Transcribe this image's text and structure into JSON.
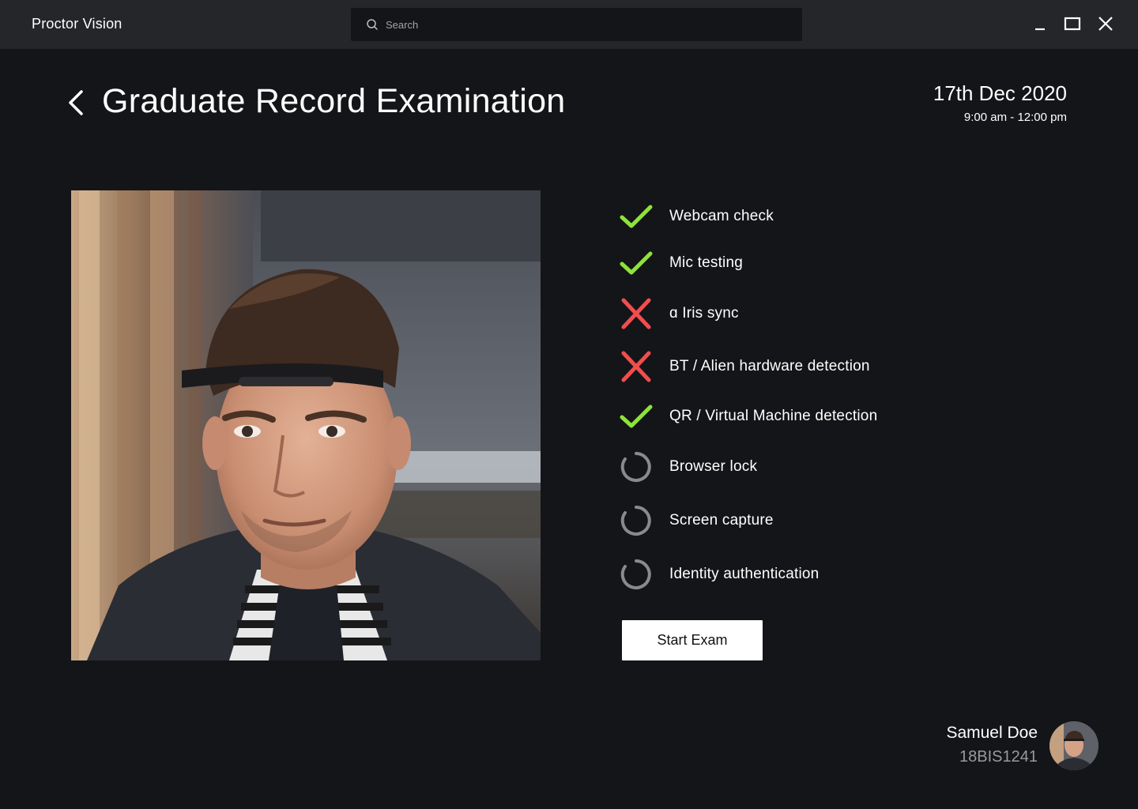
{
  "app": {
    "title": "Proctor Vision"
  },
  "search": {
    "placeholder": "Search",
    "value": ""
  },
  "window_controls": {
    "minimize": "minimize-icon",
    "maximize": "maximize-icon",
    "close": "close-icon"
  },
  "header": {
    "back_icon": "chevron-left-icon",
    "title": "Graduate Record Examination",
    "date": "17th Dec 2020",
    "time": "9:00 am - 12:00 pm"
  },
  "webcam": {
    "content": "webcam-feed-image"
  },
  "colors": {
    "titlebar_bg": "#25262a",
    "page_bg": "#141518",
    "pass": "#8ee33a",
    "fail": "#f24d4d",
    "pending": "#8a8a8a",
    "button_bg": "#ffffff"
  },
  "checks": [
    {
      "label": "Webcam check",
      "status": "pass"
    },
    {
      "label": "Mic testing",
      "status": "pass"
    },
    {
      "label": "ɑ Iris sync",
      "status": "fail"
    },
    {
      "label": "BT / Alien hardware detection",
      "status": "fail"
    },
    {
      "label": "QR / Virtual Machine detection",
      "status": "pass"
    },
    {
      "label": "Browser lock",
      "status": "pending"
    },
    {
      "label": "Screen capture",
      "status": "pending"
    },
    {
      "label": "Identity authentication",
      "status": "pending"
    }
  ],
  "actions": {
    "start_exam": "Start Exam"
  },
  "user": {
    "name": "Samuel Doe",
    "id": "18BIS1241",
    "avatar": "user-avatar-image"
  }
}
